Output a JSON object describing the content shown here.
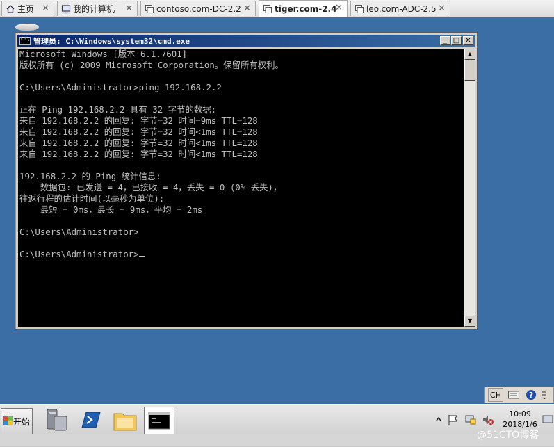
{
  "tabs": [
    {
      "label": "主页",
      "icon": "home-icon",
      "active": false
    },
    {
      "label": "我的计算机",
      "icon": "computer-icon",
      "active": false
    },
    {
      "label": "contoso.com-DC-2.2",
      "icon": "vm-icon",
      "active": false
    },
    {
      "label": "tiger.com-2.4",
      "icon": "vm-icon",
      "active": true
    },
    {
      "label": "leo.com-ADC-2.5",
      "icon": "vm-icon",
      "active": false
    }
  ],
  "cmd_window": {
    "title": "管理员: C:\\Windows\\system32\\cmd.exe",
    "lines": [
      "Microsoft Windows [版本 6.1.7601]",
      "版权所有 (c) 2009 Microsoft Corporation。保留所有权利。",
      "",
      "C:\\Users\\Administrator>ping 192.168.2.2",
      "",
      "正在 Ping 192.168.2.2 具有 32 字节的数据:",
      "来自 192.168.2.2 的回复: 字节=32 时间=9ms TTL=128",
      "来自 192.168.2.2 的回复: 字节=32 时间<1ms TTL=128",
      "来自 192.168.2.2 的回复: 字节=32 时间<1ms TTL=128",
      "来自 192.168.2.2 的回复: 字节=32 时间<1ms TTL=128",
      "",
      "192.168.2.2 的 Ping 统计信息:",
      "    数据包: 已发送 = 4，已接收 = 4，丢失 = 0 (0% 丢失)，",
      "往返行程的估计时间(以毫秒为单位):",
      "    最短 = 0ms，最长 = 9ms，平均 = 2ms",
      "",
      "C:\\Users\\Administrator>",
      "",
      "C:\\Users\\Administrator>"
    ]
  },
  "langbar": {
    "lang": "CH",
    "keyboard_icon": "keyboard-icon",
    "help_icon": "help-icon"
  },
  "taskbar": {
    "start_label": "开始",
    "pinned": [
      "server-manager-icon",
      "powershell-icon",
      "explorer-icon",
      "cmd-icon"
    ]
  },
  "tray": {
    "time": "10:09",
    "date": "2018/1/6"
  },
  "watermark": "@51CTO博客",
  "colors": {
    "console_bg": "#000000",
    "console_fg": "#c0c0c0",
    "desktop": "#3b6ea5",
    "title_start": "#0a246a",
    "title_end": "#3a6ea5"
  }
}
